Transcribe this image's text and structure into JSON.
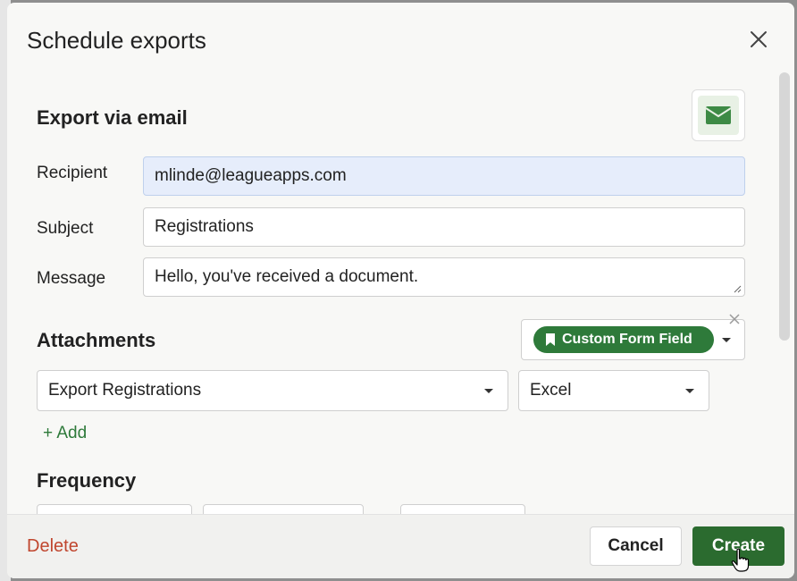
{
  "modal": {
    "title": "Schedule exports"
  },
  "email_section": {
    "title": "Export via email",
    "recipient_label": "Recipient",
    "recipient_value": "mlinde@leagueapps.com",
    "subject_label": "Subject",
    "subject_value": "Registrations",
    "message_label": "Message",
    "message_value": "Hello, you've received a document."
  },
  "attachments": {
    "title": "Attachments",
    "custom_field_label": "Custom Form Field",
    "export_select": "Export Registrations",
    "format_select": "Excel",
    "add_label": "+ Add"
  },
  "frequency": {
    "title": "Frequency"
  },
  "footer": {
    "delete_label": "Delete",
    "cancel_label": "Cancel",
    "create_label": "Create"
  },
  "colors": {
    "accent_green": "#2e7a3a",
    "create_button": "#2b6b2f",
    "delete_red": "#c0462e",
    "focused_field": "#e6edfb"
  }
}
